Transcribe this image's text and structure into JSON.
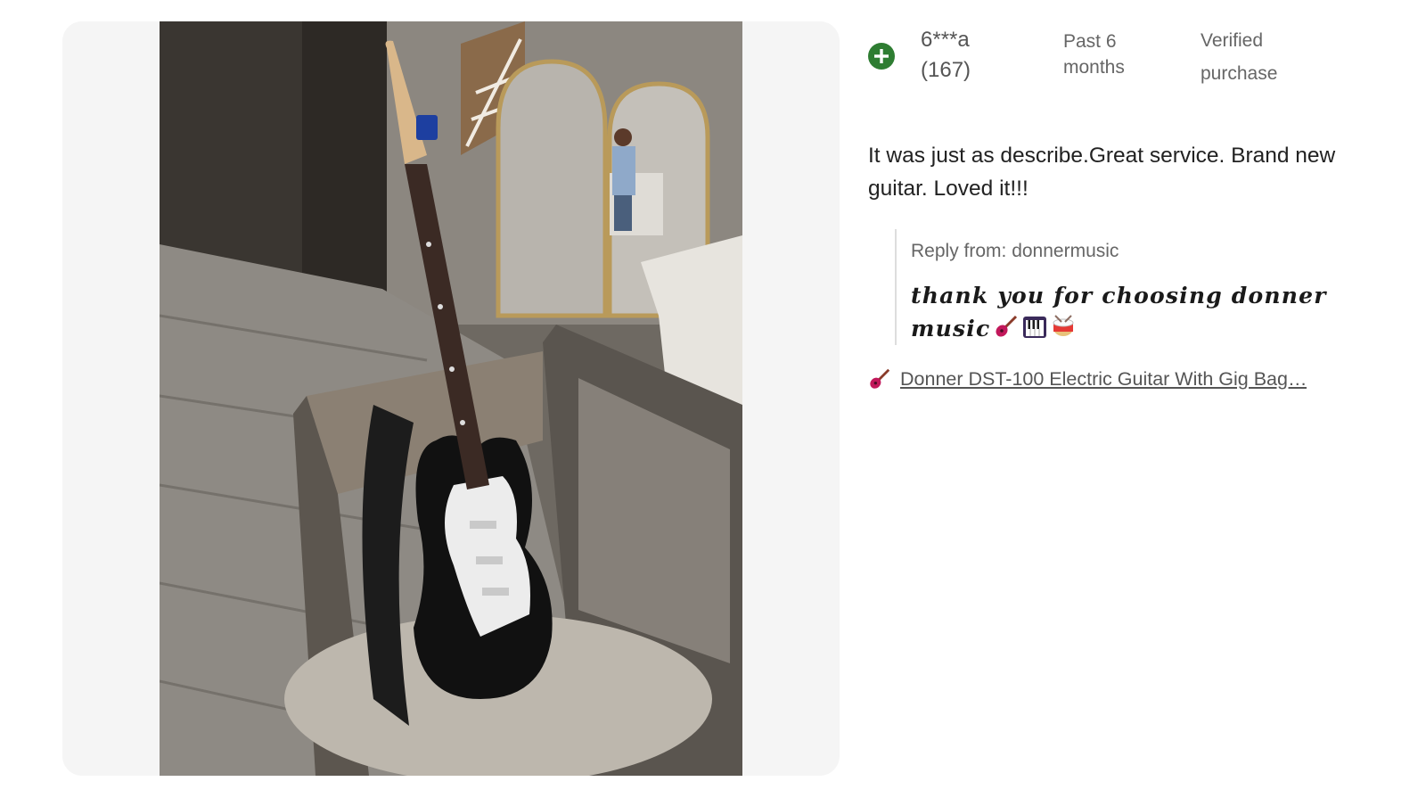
{
  "review": {
    "user": {
      "name": "6***a",
      "review_count": "(167)",
      "avatar_color": "#2e7d32"
    },
    "date": "Past 6 months",
    "badge": "Verified purchase",
    "text": "It was just as describe.Great service. Brand new guitar. Loved it!!!",
    "reply": {
      "from": "Reply from: donnermusic",
      "text": "thank you for choosing donner music"
    },
    "product_link": "Donner DST-100 Electric Guitar With Gig Bag…"
  },
  "icons": [
    "plus-circle-icon",
    "guitar-icon",
    "piano-keys-icon",
    "drum-icon"
  ],
  "colors": {
    "panel_bg": "#f5f5f5",
    "accent_green": "#2e7d32",
    "text_main": "#222222",
    "text_muted": "#666666"
  }
}
